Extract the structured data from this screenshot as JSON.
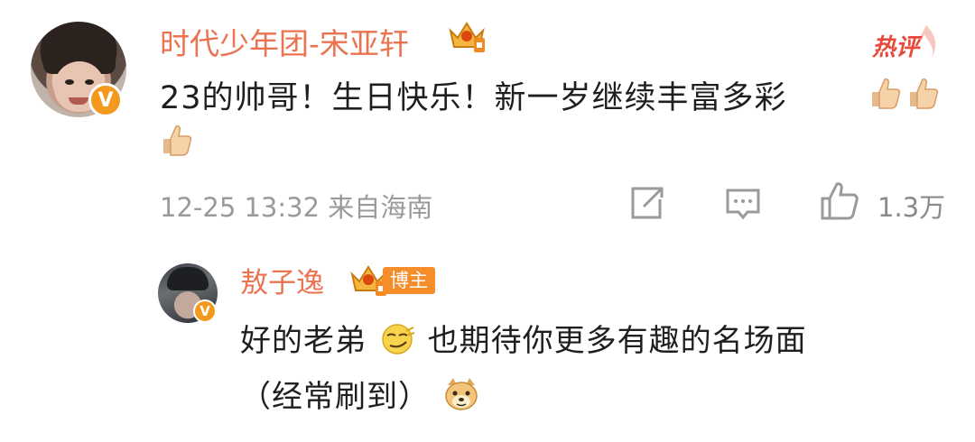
{
  "comment": {
    "author": "时代少年团-宋亚轩",
    "verified_badge": "V",
    "hot_label": "热评",
    "text_line1": "23的帅哥！生日快乐！新一岁继续丰富多彩",
    "emoji_thumbs": [
      "thumbs-up",
      "thumbs-up",
      "thumbs-up"
    ],
    "timestamp": "12-25 13:32",
    "location": "来自海南",
    "meta_text": "12-25 13:32  来自海南",
    "actions": {
      "share_icon": "share-icon",
      "reply_icon": "comment-icon",
      "like_icon": "like-icon",
      "like_count": "1.3万"
    }
  },
  "reply": {
    "author": "敖子逸",
    "verified_badge": "V",
    "role_tag": "博主",
    "text_part1": "好的老弟",
    "text_part2": "也期待你更多有趣的名场面",
    "text_line2": "（经常刷到）",
    "emoji_smirk": "smirk-emoji",
    "emoji_doge": "doge-emoji"
  },
  "colors": {
    "name": "#eb7350",
    "badge": "#f39a1e",
    "hot": "#e7493d",
    "meta": "#9a9a9a"
  }
}
